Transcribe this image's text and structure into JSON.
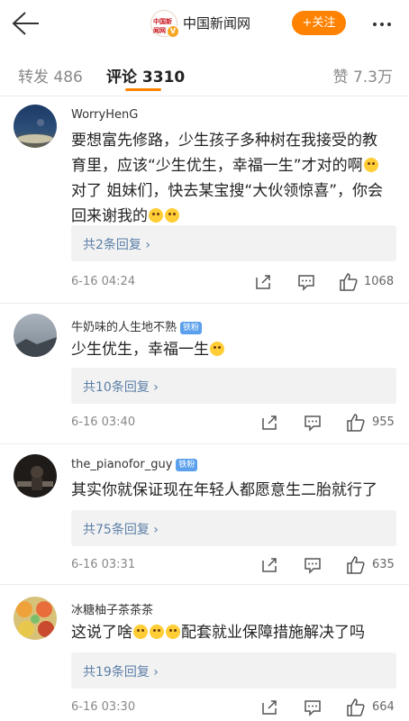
{
  "header": {
    "back_icon": "arrow-left-icon",
    "logo_text": "中国新闻网",
    "verified_badge": "V",
    "title": "中国新闻网",
    "follow_label": "+关注",
    "more_icon": "ellipsis-icon",
    "accent_color": "#ff8200"
  },
  "tabs": {
    "repost": "转发 486",
    "comment": "评论 3310",
    "like": "赞 7.3万"
  },
  "comments": [
    {
      "username": "WorryHenG",
      "badge": "",
      "text_lines": [
        "要想富先修路，少生孩子多种树在我接受的教",
        "育里，应该“少生优生，幸福一生”才对的啊",
        "对了 姐妹们，快去某宝搜“大伙领惊喜”，你会",
        "回来谢我的"
      ],
      "replies": "共2条回复 ›",
      "time": "6-16 04:24",
      "likes": "1068"
    },
    {
      "username": "牛奶味的人生地不熟",
      "badge": "铁粉",
      "text_lines": [
        "少生优生，幸福一生"
      ],
      "replies": "共10条回复 ›",
      "time": "6-16 03:40",
      "likes": "955"
    },
    {
      "username": "the_pianofor_guy",
      "badge": "铁粉",
      "text_lines": [
        "其实你就保证现在年轻人都愿意生二胎就行了"
      ],
      "replies": "共75条回复 ›",
      "time": "6-16 03:31",
      "likes": "635"
    },
    {
      "username": "冰糖柚子茶茶茶",
      "badge": "",
      "text_lines": [
        "这说了啥",
        "配套就业保障措施解决了吗"
      ],
      "replies": "共19条回复 ›",
      "time": "6-16 03:30",
      "likes": "664"
    }
  ],
  "icons": {
    "share": "share-icon",
    "reply": "comment-icon",
    "like": "thumbs-up-icon"
  }
}
